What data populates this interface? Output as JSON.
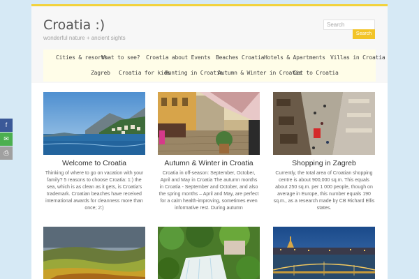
{
  "site": {
    "title": "Croatia :)",
    "tagline": "wonderful nature + ancient sights"
  },
  "search": {
    "placeholder": "Search",
    "button_label": "Search"
  },
  "nav": {
    "items": [
      {
        "label": "Cities & resorts"
      },
      {
        "label": "What to see?"
      },
      {
        "label": "Croatia about Events"
      },
      {
        "label": "Beaches Croatia"
      },
      {
        "label": "Hotels & Apartments"
      },
      {
        "label": "Villas in Croatia"
      },
      {
        "label": "Zagreb"
      },
      {
        "label": "Croatia for kids"
      },
      {
        "label": "Hunting in Croatia"
      },
      {
        "label": "Autumn & Winter in Croatia"
      },
      {
        "label": "Get to Croatia"
      }
    ]
  },
  "posts": [
    {
      "title": "Welcome to Croatia",
      "excerpt": "Thinking of where to go on vacation with your family? 5 reasons to choose Croatia: 1:) the sea, which is as clean as it gets, is Croatia's trademark. Croatian beaches have received international awards for cleanness more than once; 2:)"
    },
    {
      "title": "Autumn & Winter in Croatia",
      "excerpt": "Croatia in off-season: September, October, April and May in Croatia The autumn months in Croatia - September and October, and also the spring months – April and May, are perfect for a calm health-improving, sometimes even informative rest. During autumn"
    },
    {
      "title": "Shopping in Zagreb",
      "excerpt": "Currently, the total area of Croatian shopping centre is about 900,000 sq.m. This equals about 250 sq.m. per 1 000 people, though on average in Europe, this number equals 190 sq.m., as a research made by CB Richard Ellis states."
    }
  ],
  "share": [
    {
      "icon": "facebook-icon",
      "glyph": "f",
      "color": "#3b5998"
    },
    {
      "icon": "email-icon",
      "glyph": "✉",
      "color": "#4caf50"
    },
    {
      "icon": "print-icon",
      "glyph": "⎙",
      "color": "#a0a0a0"
    }
  ],
  "colors": {
    "accent": "#f2c428",
    "background": "#d6e9f5",
    "nav_background": "#fffde8"
  }
}
